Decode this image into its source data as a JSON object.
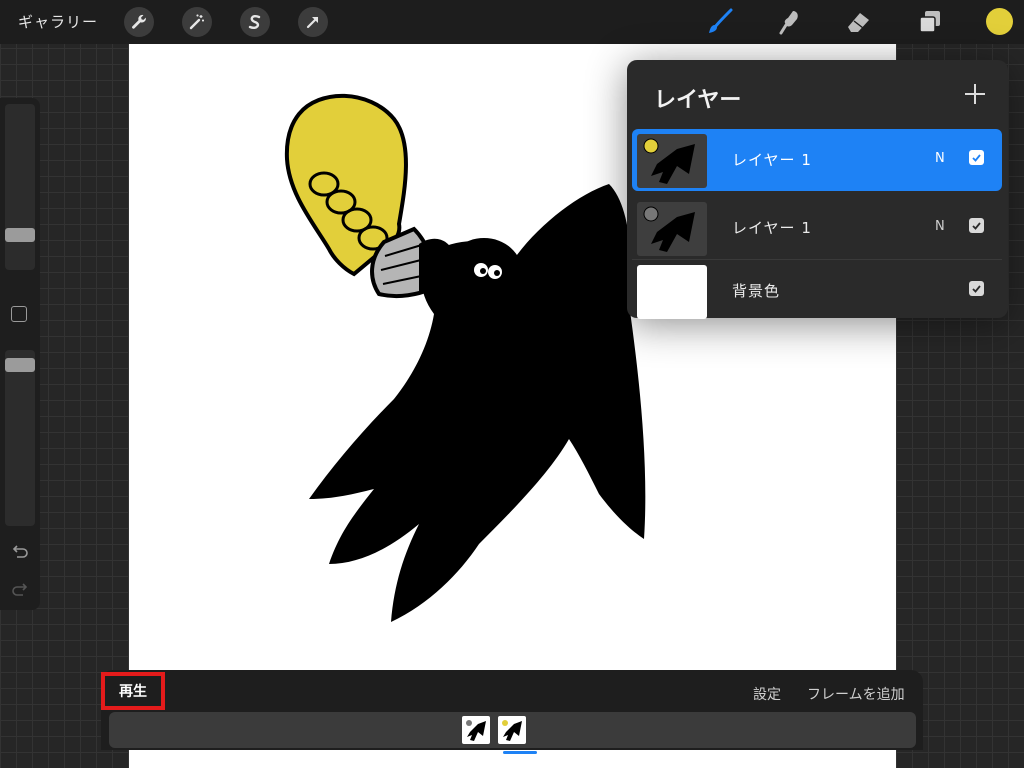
{
  "topbar": {
    "gallery_label": "ギャラリー",
    "tools": [
      "wrench-icon",
      "magic-wand-icon",
      "selection-icon",
      "transform-icon"
    ],
    "right_tools": [
      "brush-icon",
      "smudge-icon",
      "eraser-icon",
      "layers-icon"
    ],
    "brush_color": "#1e82f5",
    "current_color": "#e2cf3a"
  },
  "layers": {
    "title": "レイヤー",
    "items": [
      {
        "name": "レイヤー 1",
        "blend": "N",
        "selected": true
      },
      {
        "name": "レイヤー 1",
        "blend": "N",
        "selected": false
      },
      {
        "name": "背景色",
        "blend": "",
        "selected": false
      }
    ]
  },
  "animation": {
    "play_label": "再生",
    "settings_label": "設定",
    "add_frame_label": "フレームを追加",
    "frame_count": 2
  },
  "colors": {
    "accent": "#1e82f5",
    "bulb": "#e2cf3a",
    "highlight_box": "#e41b1b"
  }
}
